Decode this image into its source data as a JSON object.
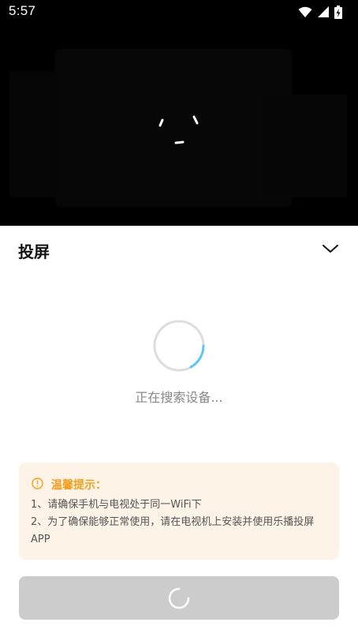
{
  "status_bar": {
    "time": "5:57",
    "icons": [
      "wifi-icon",
      "cell-signal-icon",
      "battery-charging-icon"
    ]
  },
  "video": {
    "loader_icon": "loading-spinner-icon"
  },
  "sheet": {
    "title": "投屏",
    "collapse_icon": "chevron-down-icon",
    "searching_text": "正在搜索设备...",
    "tips": {
      "icon": "info-icon",
      "title": "温馨提示：",
      "line1": "1、请确保手机与电视处于同一WiFi下",
      "line2": "2、为了确保能够正常使用，请在电视机上安装并使用乐播投屏APP"
    },
    "action_button": {
      "state": "loading"
    }
  },
  "colors": {
    "accent_tip": "#f0a020",
    "tip_bg": "#fdf3e6",
    "spinner_blue": "#5ec8f2",
    "button_disabled": "#cccccc"
  }
}
